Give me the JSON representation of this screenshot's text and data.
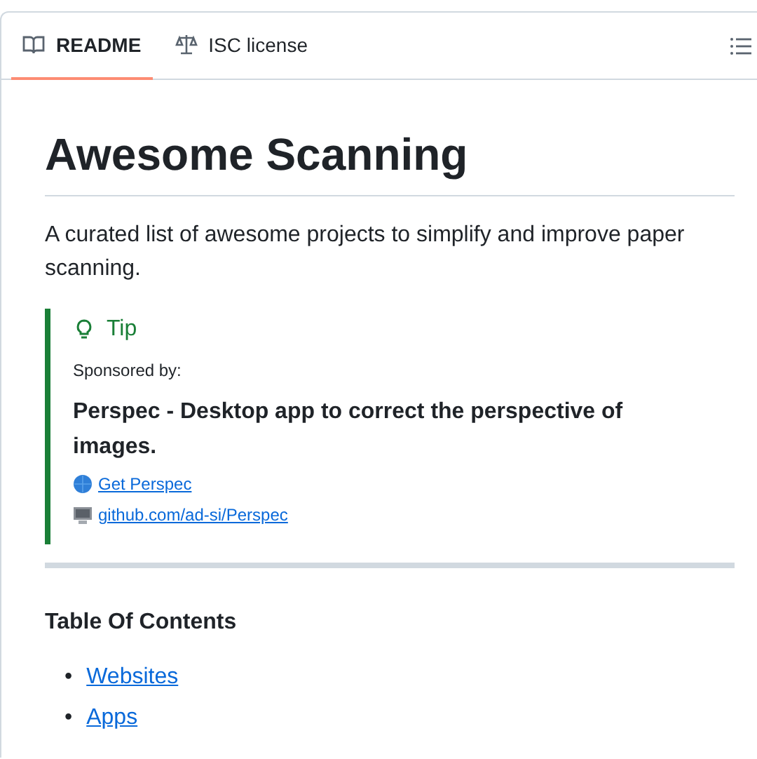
{
  "tabs": [
    {
      "label": "README",
      "selected": true
    },
    {
      "label": "ISC license",
      "selected": false
    }
  ],
  "title": "Awesome Scanning",
  "description": "A curated list of awesome projects to simplify and improve paper scanning.",
  "tip": {
    "label": "Tip",
    "sponsored": "Sponsored by:",
    "headline": "Perspec - Desktop app to correct the perspective of images.",
    "links": [
      {
        "label": "Get Perspec"
      },
      {
        "label": "github.com/ad-si/Perspec"
      }
    ]
  },
  "toc": {
    "title": "Table Of Contents",
    "items": [
      {
        "marker": "•",
        "label": "Websites"
      },
      {
        "marker": "•",
        "label": "Apps"
      }
    ]
  }
}
